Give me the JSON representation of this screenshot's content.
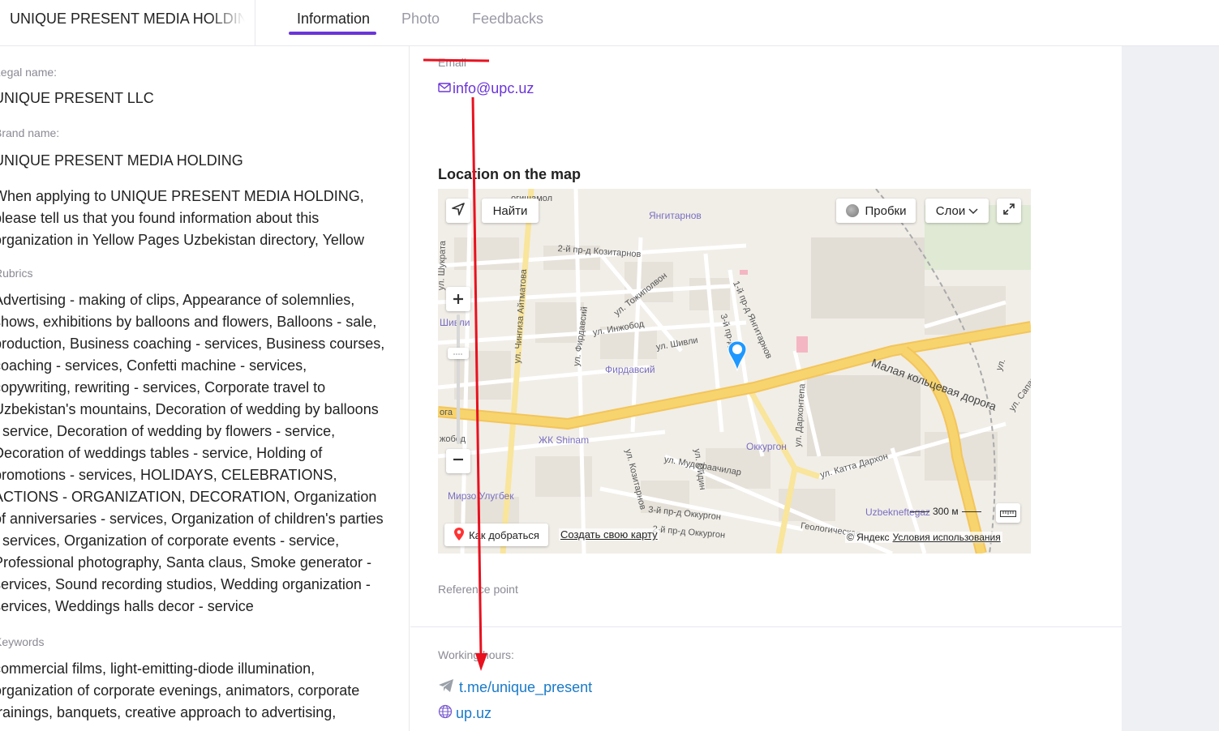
{
  "header": {
    "company_title": "UNIQUE PRESENT MEDIA HOLDING",
    "tabs": [
      {
        "label": "Information",
        "active": true
      },
      {
        "label": "Photo",
        "active": false
      },
      {
        "label": "Feedbacks",
        "active": false
      }
    ]
  },
  "left": {
    "legal_name_label": "Legal name:",
    "legal_name": "UNIQUE PRESENT LLC",
    "brand_name_label": "Brand name:",
    "brand_name": "UNIQUE PRESENT MEDIA HOLDING",
    "description_lines": [
      "When applying to UNIQUE PRESENT MEDIA HOLDING,",
      "please tell us that you found information about this",
      "organization in Yellow Pages Uzbekistan directory, Yellow"
    ],
    "rubrics_label": "Rubrics",
    "rubrics_lines": [
      "Advertising - making of clips, Appearance of solemnlies,",
      "shows, exhibitions by balloons and flowers, Balloons - sale,",
      "production, Business coaching - services, Business courses,",
      "coaching - services, Confetti machine - services,",
      "copywriting, rewriting - services, Corporate travel to",
      "Uzbekistan's mountains, Decoration of wedding by balloons",
      "- service, Decoration of wedding by flowers - service,",
      "Decoration of weddings tables - service, Holding of",
      "promotions - services, HOLIDAYS, CELEBRATIONS,",
      "ACTIONS - ORGANIZATION, DECORATION, Organization",
      "of anniversaries - services, Organization of children's parties",
      "- services, Organization of corporate events - service,",
      "Professional photography, Santa claus, Smoke generator -",
      "services, Sound recording studios, Wedding organization -",
      "services, Weddings halls decor - service"
    ],
    "keywords_label": "Keywords",
    "keywords_lines": [
      "commercial films, light-emitting-diode illumination,",
      "organization of corporate evenings, animators, corporate",
      "trainings, banquets, creative approach to advertising,"
    ]
  },
  "main": {
    "email_label": "Email",
    "email": "info@upc.uz",
    "map_title": "Location on the map",
    "reference_label": "Reference point",
    "working_hours_label": "Working hours:",
    "telegram_link": "t.me/unique_present",
    "website_link": "up.uz"
  },
  "map": {
    "find_button": "Найти",
    "traffic_button": "Пробки",
    "layers_button": "Слои",
    "route_button": "Как добраться",
    "create_map_link": "Создать свою карту",
    "scale_label": "300 м",
    "copyright": "© Яндекс",
    "terms_link": "Условия использования",
    "streets": {
      "s1": "огишамол",
      "s2": "Янгитарнов",
      "s3": "2-й пр-д Козитарнов",
      "s4": "ул. Шукрата",
      "s5": "ул. Чингиза Айтматова",
      "s6": "ул. Тожиполвон",
      "s7": "ул. Инжобод",
      "s8": "ул. Фирдавсий",
      "s9": "ул. Шивли",
      "s10": "1-й пр-д Янгитарнов",
      "s11": "3-й пр-д",
      "s12": "Малая кольцевая дорога",
      "s13": "Фирдавсий",
      "s14": "ул. Козитарнов",
      "s15": "ул. Ойдин",
      "s16": "ул. Дархонтепа",
      "s17": "ЖК Shinam",
      "s18": "Оккургон",
      "s19": "ул. Мудофаачилар",
      "s20": "ул. Катта Дархон",
      "s21": "Мирзо Улугбек",
      "s22": "3-й пр-д Оккургон",
      "s23": "2-й пр-д Оккургон",
      "s24": "Геологическая",
      "s25": "Uzbekneftegaz",
      "s26": "ул. Сапар",
      "s27": "Шивли",
      "s28": "ога",
      "s29": "жобод",
      "s30": "ул."
    }
  },
  "colors": {
    "accent": "#6b35d9",
    "link": "#1a7ac8",
    "annotation": "#e8111f",
    "road_major": "#f7d46e"
  }
}
